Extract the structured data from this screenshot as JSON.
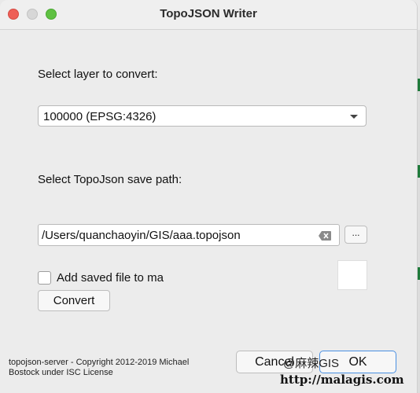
{
  "window": {
    "title": "TopoJSON Writer"
  },
  "layer": {
    "label": "Select layer to convert:",
    "selected": "100000 (EPSG:4326)"
  },
  "save_path": {
    "label": "Select TopoJson save path:",
    "value": "/Users/quanchaoyin/GIS/aaa.topojson",
    "browse_label": "..."
  },
  "add_file": {
    "label": "Add saved file to ma",
    "checked": false
  },
  "buttons": {
    "convert": "Convert",
    "cancel": "Cancel",
    "ok": "OK"
  },
  "credit": {
    "line1": "topojson-server - Copyright 2012-2019 Michael",
    "line2": "Bostock under ISC License"
  },
  "watermark": {
    "text": "@麻辣GIS",
    "url": "http://malagis.com"
  },
  "colors": {
    "close": "#ee5f57",
    "minimize": "#d7d7d7",
    "maximize": "#5fc142",
    "ok_border": "#4a90e2"
  },
  "icons": {
    "clear": "clear-field-icon",
    "dropdown": "dropdown-caret-icon"
  }
}
